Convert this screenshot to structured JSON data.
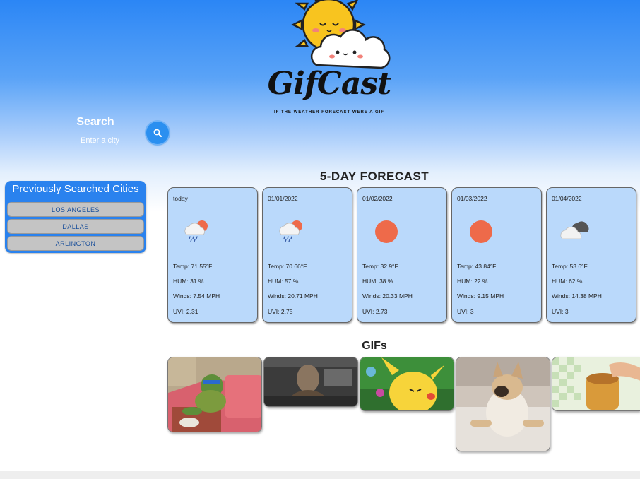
{
  "app": {
    "logo_title": "GifCast",
    "logo_tagline": "IF THE WEATHER FORECAST WERE A GIF"
  },
  "search": {
    "title": "Search",
    "placeholder": "Enter a city",
    "button_icon": "search-icon"
  },
  "history": {
    "title": "Previously Searched Cities",
    "cities": [
      "LOS ANGELES",
      "DALLAS",
      "ARLINGTON"
    ]
  },
  "forecast": {
    "heading": "5-DAY FORECAST",
    "days": [
      {
        "date": "today",
        "icon": "cloud-rain-sun-icon",
        "temp": "Temp: 71.55°F",
        "hum": "HUM: 31 %",
        "winds": "Winds: 7.54 MPH",
        "uvi": "UVI: 2.31"
      },
      {
        "date": "01/01/2022",
        "icon": "cloud-rain-sun-icon",
        "temp": "Temp: 70.66°F",
        "hum": "HUM: 57 %",
        "winds": "Winds: 20.71 MPH",
        "uvi": "UVI: 2.75"
      },
      {
        "date": "01/02/2022",
        "icon": "sun-icon",
        "temp": "Temp: 32.9°F",
        "hum": "HUM: 38 %",
        "winds": "Winds: 20.33 MPH",
        "uvi": "UVI: 2.73"
      },
      {
        "date": "01/03/2022",
        "icon": "sun-icon",
        "temp": "Temp: 43.84°F",
        "hum": "HUM: 22 %",
        "winds": "Winds: 9.15 MPH",
        "uvi": "UVI: 3"
      },
      {
        "date": "01/04/2022",
        "icon": "cloudy-icon",
        "temp": "Temp: 53.6°F",
        "hum": "HUM: 62 %",
        "winds": "Winds: 14.38 MPH",
        "uvi": "UVI: 3"
      }
    ]
  },
  "gifs": {
    "heading": "GIFs",
    "items": [
      "turtle-gif",
      "dark-figure-gif",
      "pikachu-gif",
      "pug-gif",
      "jar-gif"
    ]
  },
  "colors": {
    "accent": "#2a82ee",
    "card_bg": "#bad9fb",
    "sun": "#ee6a4a"
  }
}
